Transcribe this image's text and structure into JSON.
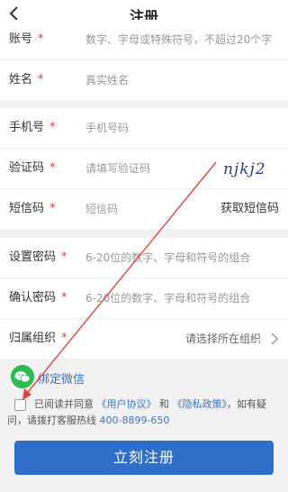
{
  "header": {
    "title": "注册",
    "back_icon": "chevron-left-icon"
  },
  "form": {
    "account": {
      "label": "账号",
      "placeholder": "数字、字母或特殊符号，不超过20个字"
    },
    "name": {
      "label": "姓名",
      "placeholder": "真实姓名"
    },
    "phone": {
      "label": "手机号",
      "placeholder": "手机号码"
    },
    "captcha": {
      "label": "验证码",
      "placeholder": "请填写验证码",
      "image_text": "njkj2"
    },
    "sms": {
      "label": "短信码",
      "placeholder": "短信码",
      "button": "获取短信码"
    },
    "password": {
      "label": "设置密码",
      "placeholder": "6-20位的数字、字母和符号的组合"
    },
    "confirm": {
      "label": "确认密码",
      "placeholder": "6-20位的数字、字母和符号的组合"
    },
    "org": {
      "label": "归属组织",
      "placeholder": "请选择所在组织",
      "chevron_icon": "chevron-right-icon"
    },
    "required_mark": "*"
  },
  "wechat": {
    "label": "绑定微信",
    "icon": "wechat-icon"
  },
  "agreement": {
    "prefix": "已阅读并同意",
    "user_agreement": "《用户协议》",
    "and": "和",
    "privacy": "《隐私政策》",
    "suffix": "，如有疑问，请拨打客服热线",
    "hotline": "400-8899-650"
  },
  "submit": {
    "label": "立刻注册"
  },
  "colors": {
    "accent": "#2f6fc9",
    "required": "#e53935",
    "wechat": "#2dbb55",
    "annotation_arrow": "#e0433a"
  }
}
